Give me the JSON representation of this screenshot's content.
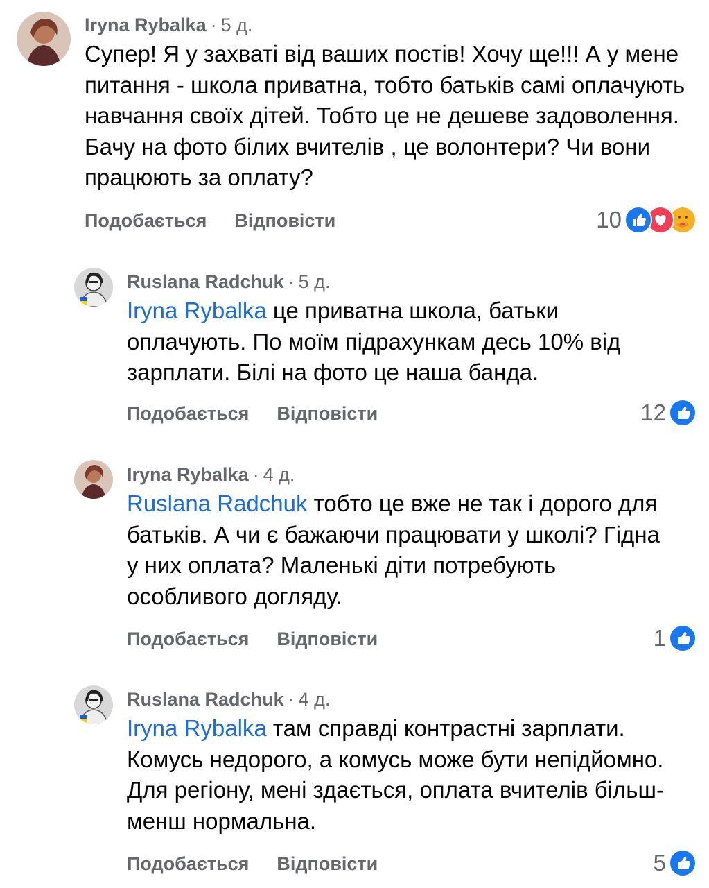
{
  "comments": [
    {
      "author": "Iryna Rybalka",
      "time": "5 д.",
      "mention": "",
      "text": "Супер! Я у захваті від ваших постів! Хочу ще!!! А у мене питання - школа приватна, тобто батьків самі оплачують навчання своїх дітей. Тобто це не дешеве задоволення. Бачу на фото білих вчителів , це волонтери? Чи вони працюють за оплату?",
      "like_label": "Подобається",
      "reply_label": "Відповісти",
      "reaction_count": "10",
      "reactions": [
        "like-icon",
        "love-icon",
        "care-icon"
      ]
    },
    {
      "author": "Ruslana Radchuk",
      "time": "5 д.",
      "mention": "Iryna Rybalka",
      "text": " це приватна школа, батьки оплачують. По моїм підрахункам десь 10% від зарплати. Білі на фото це наша банда.",
      "like_label": "Подобається",
      "reply_label": "Відповісти",
      "reaction_count": "12",
      "reactions": [
        "like-icon"
      ]
    },
    {
      "author": "Iryna Rybalka",
      "time": "4 д.",
      "mention": "Ruslana Radchuk",
      "text": " тобто це вже не так і дорого для батьків. А чи є бажаючи працювати у школі? Гідна у них оплата? Маленькі діти потребують особливого догляду.",
      "like_label": "Подобається",
      "reply_label": "Відповісти",
      "reaction_count": "1",
      "reactions": [
        "like-icon"
      ]
    },
    {
      "author": "Ruslana Radchuk",
      "time": "4 д.",
      "mention": "Iryna Rybalka",
      "text": " там справді контрастні зарплати. Комусь недорого, а комусь може бути непідйомно. Для регіону, мені здається, оплата вчителів більш-менш нормальна.",
      "like_label": "Подобається",
      "reply_label": "Відповісти",
      "reaction_count": "5",
      "reactions": [
        "like-icon"
      ]
    }
  ],
  "colors": {
    "mention": "#1a6ed8",
    "secondary_text": "#65676b",
    "like": "#1877f2",
    "love": "#f33e58",
    "care": "#f7b125"
  }
}
